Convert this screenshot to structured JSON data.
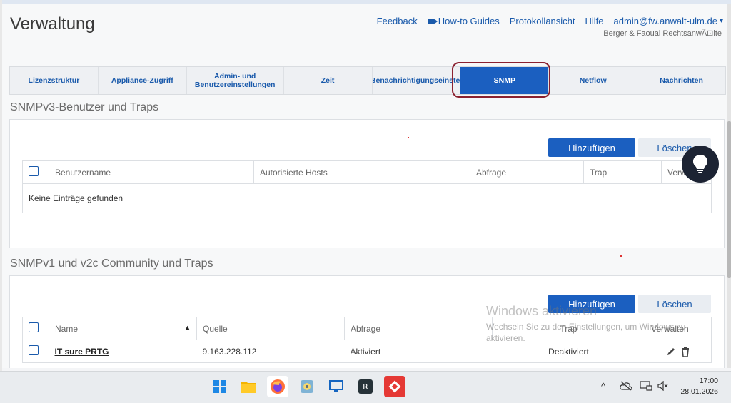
{
  "header": {
    "title": "Verwaltung",
    "nav": [
      "Feedback",
      "How-to Guides",
      "Protokollansicht",
      "Hilfe",
      "admin@fw.anwalt-ulm.de"
    ],
    "company": "Berger & Faoual RechtsanwÃ⊡lte"
  },
  "tabs": [
    {
      "label": "Lizenzstruktur"
    },
    {
      "label": "Appliance-Zugriff"
    },
    {
      "label": "Admin- und Benutzereinstellungen"
    },
    {
      "label": "Zeit"
    },
    {
      "label": "Benachrichtigungseinste"
    },
    {
      "label": "SNMP",
      "active": true
    },
    {
      "label": "Netflow"
    },
    {
      "label": "Nachrichten"
    }
  ],
  "snmpv3": {
    "heading": "SNMPv3-Benutzer und Traps",
    "add_label": "Hinzufügen",
    "delete_label": "Löschen",
    "columns": [
      "Benutzername",
      "Autorisierte Hosts",
      "Abfrage",
      "Trap",
      "Verw"
    ],
    "empty_text": "Keine Einträge gefunden"
  },
  "snmpv1": {
    "heading": "SNMPv1 und v2c Community und Traps",
    "add_label": "Hinzufügen",
    "delete_label": "Löschen",
    "columns": [
      "Name",
      "Quelle",
      "Abfrage",
      "Trap",
      "Verwalten"
    ],
    "rows": [
      {
        "name": "IT sure PRTG",
        "quelle": "9.163.228.112",
        "abfrage": "Aktiviert",
        "trap": "Deaktiviert"
      }
    ]
  },
  "watermark": {
    "title": "Windows aktivieren",
    "text": "Wechseln Sie zu den Einstellungen, um Windows zu aktivieren."
  },
  "taskbar": {
    "time": "17:00",
    "date": "28.01.2026"
  }
}
